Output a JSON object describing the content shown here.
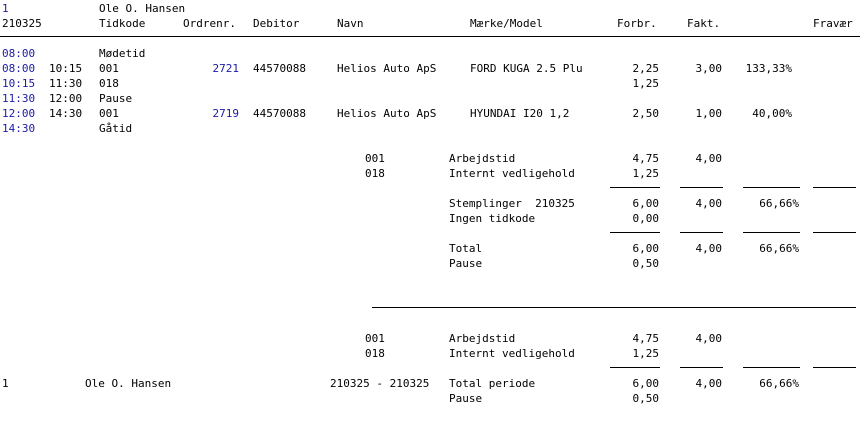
{
  "header": {
    "emp_no": "1",
    "emp_name": "Ole O. Hansen",
    "date": "210325",
    "cols": [
      "Tidkode",
      "Ordrenr.",
      "Debitor",
      "Navn",
      "Mærke/Model",
      "Forbr.",
      "Fakt.",
      "Fravær"
    ]
  },
  "rows": [
    {
      "from": "08:00",
      "to": "",
      "code": "Mødetid",
      "order": "",
      "debitor": "",
      "name": "",
      "model": "",
      "forbr": "",
      "fakt": "",
      "pct": ""
    },
    {
      "from": "08:00",
      "to": "10:15",
      "code": "001",
      "order": "2721",
      "debitor": "44570088",
      "name": "Helios Auto ApS",
      "model": "FORD KUGA 2.5 Plu",
      "forbr": "2,25",
      "fakt": "3,00",
      "pct": "133,33%"
    },
    {
      "from": "10:15",
      "to": "11:30",
      "code": "018",
      "order": "",
      "debitor": "",
      "name": "",
      "model": "",
      "forbr": "1,25",
      "fakt": "",
      "pct": ""
    },
    {
      "from": "11:30",
      "to": "12:00",
      "code": "Pause",
      "order": "",
      "debitor": "",
      "name": "",
      "model": "",
      "forbr": "",
      "fakt": "",
      "pct": ""
    },
    {
      "from": "12:00",
      "to": "14:30",
      "code": "001",
      "order": "2719",
      "debitor": "44570088",
      "name": "Helios Auto ApS",
      "model": "HYUNDAI I20 1,2",
      "forbr": "2,50",
      "fakt": "1,00",
      "pct": "40,00%"
    },
    {
      "from": "14:30",
      "to": "",
      "code": "Gåtid",
      "order": "",
      "debitor": "",
      "name": "",
      "model": "",
      "forbr": "",
      "fakt": "",
      "pct": ""
    }
  ],
  "day_summary": {
    "codes": [
      {
        "code": "001",
        "label": "Arbejdstid",
        "forbr": "4,75",
        "fakt": "4,00"
      },
      {
        "code": "018",
        "label": "Internt vedligehold",
        "forbr": "1,25",
        "fakt": ""
      }
    ],
    "stamp_label": "Stemplinger  210325",
    "stamp_forbr": "6,00",
    "stamp_fakt": "4,00",
    "stamp_pct": "66,66%",
    "notime_label": "Ingen tidkode",
    "notime_forbr": "0,00",
    "total_label": "Total",
    "total_forbr": "6,00",
    "total_fakt": "4,00",
    "total_pct": "66,66%",
    "pause_label": "Pause",
    "pause_forbr": "0,50"
  },
  "period_summary": {
    "codes": [
      {
        "code": "001",
        "label": "Arbejdstid",
        "forbr": "4,75",
        "fakt": "4,00"
      },
      {
        "code": "018",
        "label": "Internt vedligehold",
        "forbr": "1,25",
        "fakt": ""
      }
    ],
    "emp_no": "1",
    "emp_name": "Ole O. Hansen",
    "period": "210325 - 210325",
    "total_label": "Total periode",
    "total_forbr": "6,00",
    "total_fakt": "4,00",
    "total_pct": "66,66%",
    "pause_label": "Pause",
    "pause_forbr": "0,50"
  }
}
